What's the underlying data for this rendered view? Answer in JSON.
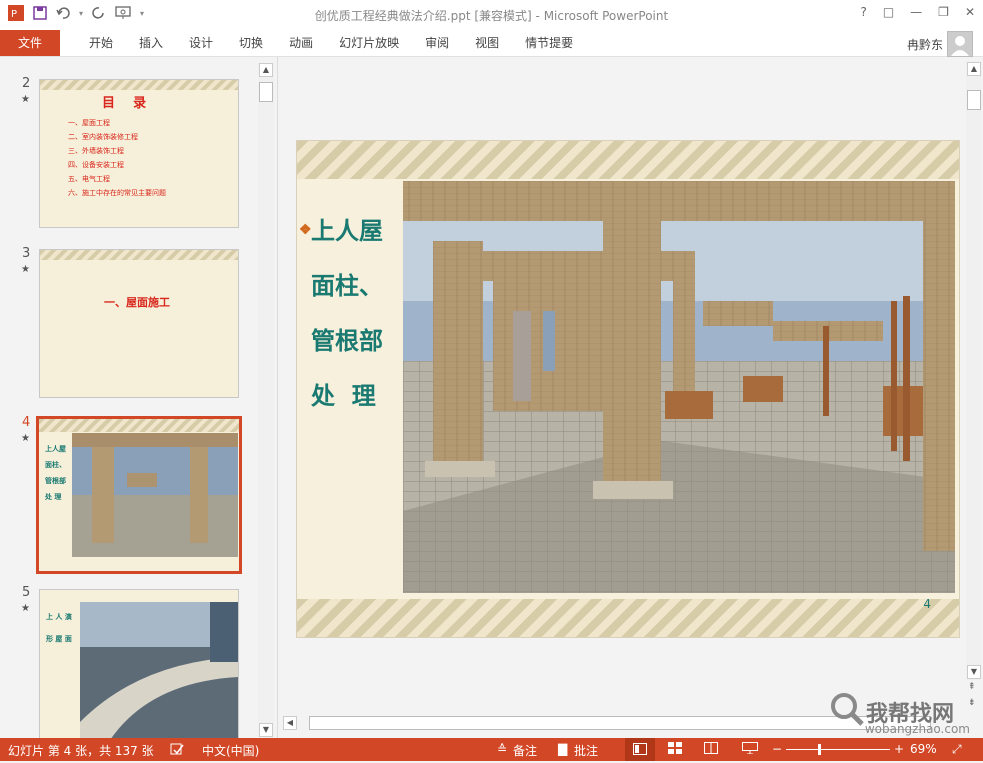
{
  "window": {
    "title": "创优质工程经典做法介绍.ppt [兼容模式] - Microsoft PowerPoint",
    "controls": [
      "?",
      "□",
      "—",
      "❐",
      "✕"
    ]
  },
  "ribbon": {
    "file_tab": "文件",
    "tabs": [
      "开始",
      "插入",
      "设计",
      "切换",
      "动画",
      "幻灯片放映",
      "审阅",
      "视图",
      "情节提要"
    ],
    "user": "冉黔东"
  },
  "thumbnails": [
    {
      "number": "2",
      "star": "★",
      "title": "目    录",
      "items": [
        "一、屋面工程",
        "二、室内装饰装修工程",
        "三、外墙装饰工程",
        "四、设备安装工程",
        "五、电气工程",
        "六、施工中存在的常见主要问题"
      ]
    },
    {
      "number": "3",
      "star": "★",
      "title": "一、屋面施工"
    },
    {
      "number": "4",
      "star": "★",
      "lines": [
        "上人屋",
        "面柱、",
        "管根部",
        "处  理"
      ]
    },
    {
      "number": "5",
      "star": "★",
      "lines": [
        "上 人 演",
        "形 屋 面"
      ]
    }
  ],
  "slide": {
    "bullet": "❖",
    "title_lines": [
      "上人屋",
      "面柱、",
      "管根部",
      "处  理"
    ],
    "number": "4"
  },
  "status": {
    "slide_info": "幻灯片 第 4 张，共 137 张",
    "language": "中文(中国)",
    "notes": "备注",
    "comments": "批注",
    "zoom": "69%"
  },
  "watermark": {
    "cn": "我帮找网",
    "url": "wobangzhao.com"
  },
  "colors": {
    "accent": "#d24726",
    "title_teal": "#1a7a72",
    "slide_bg": "#f7f0dc"
  }
}
